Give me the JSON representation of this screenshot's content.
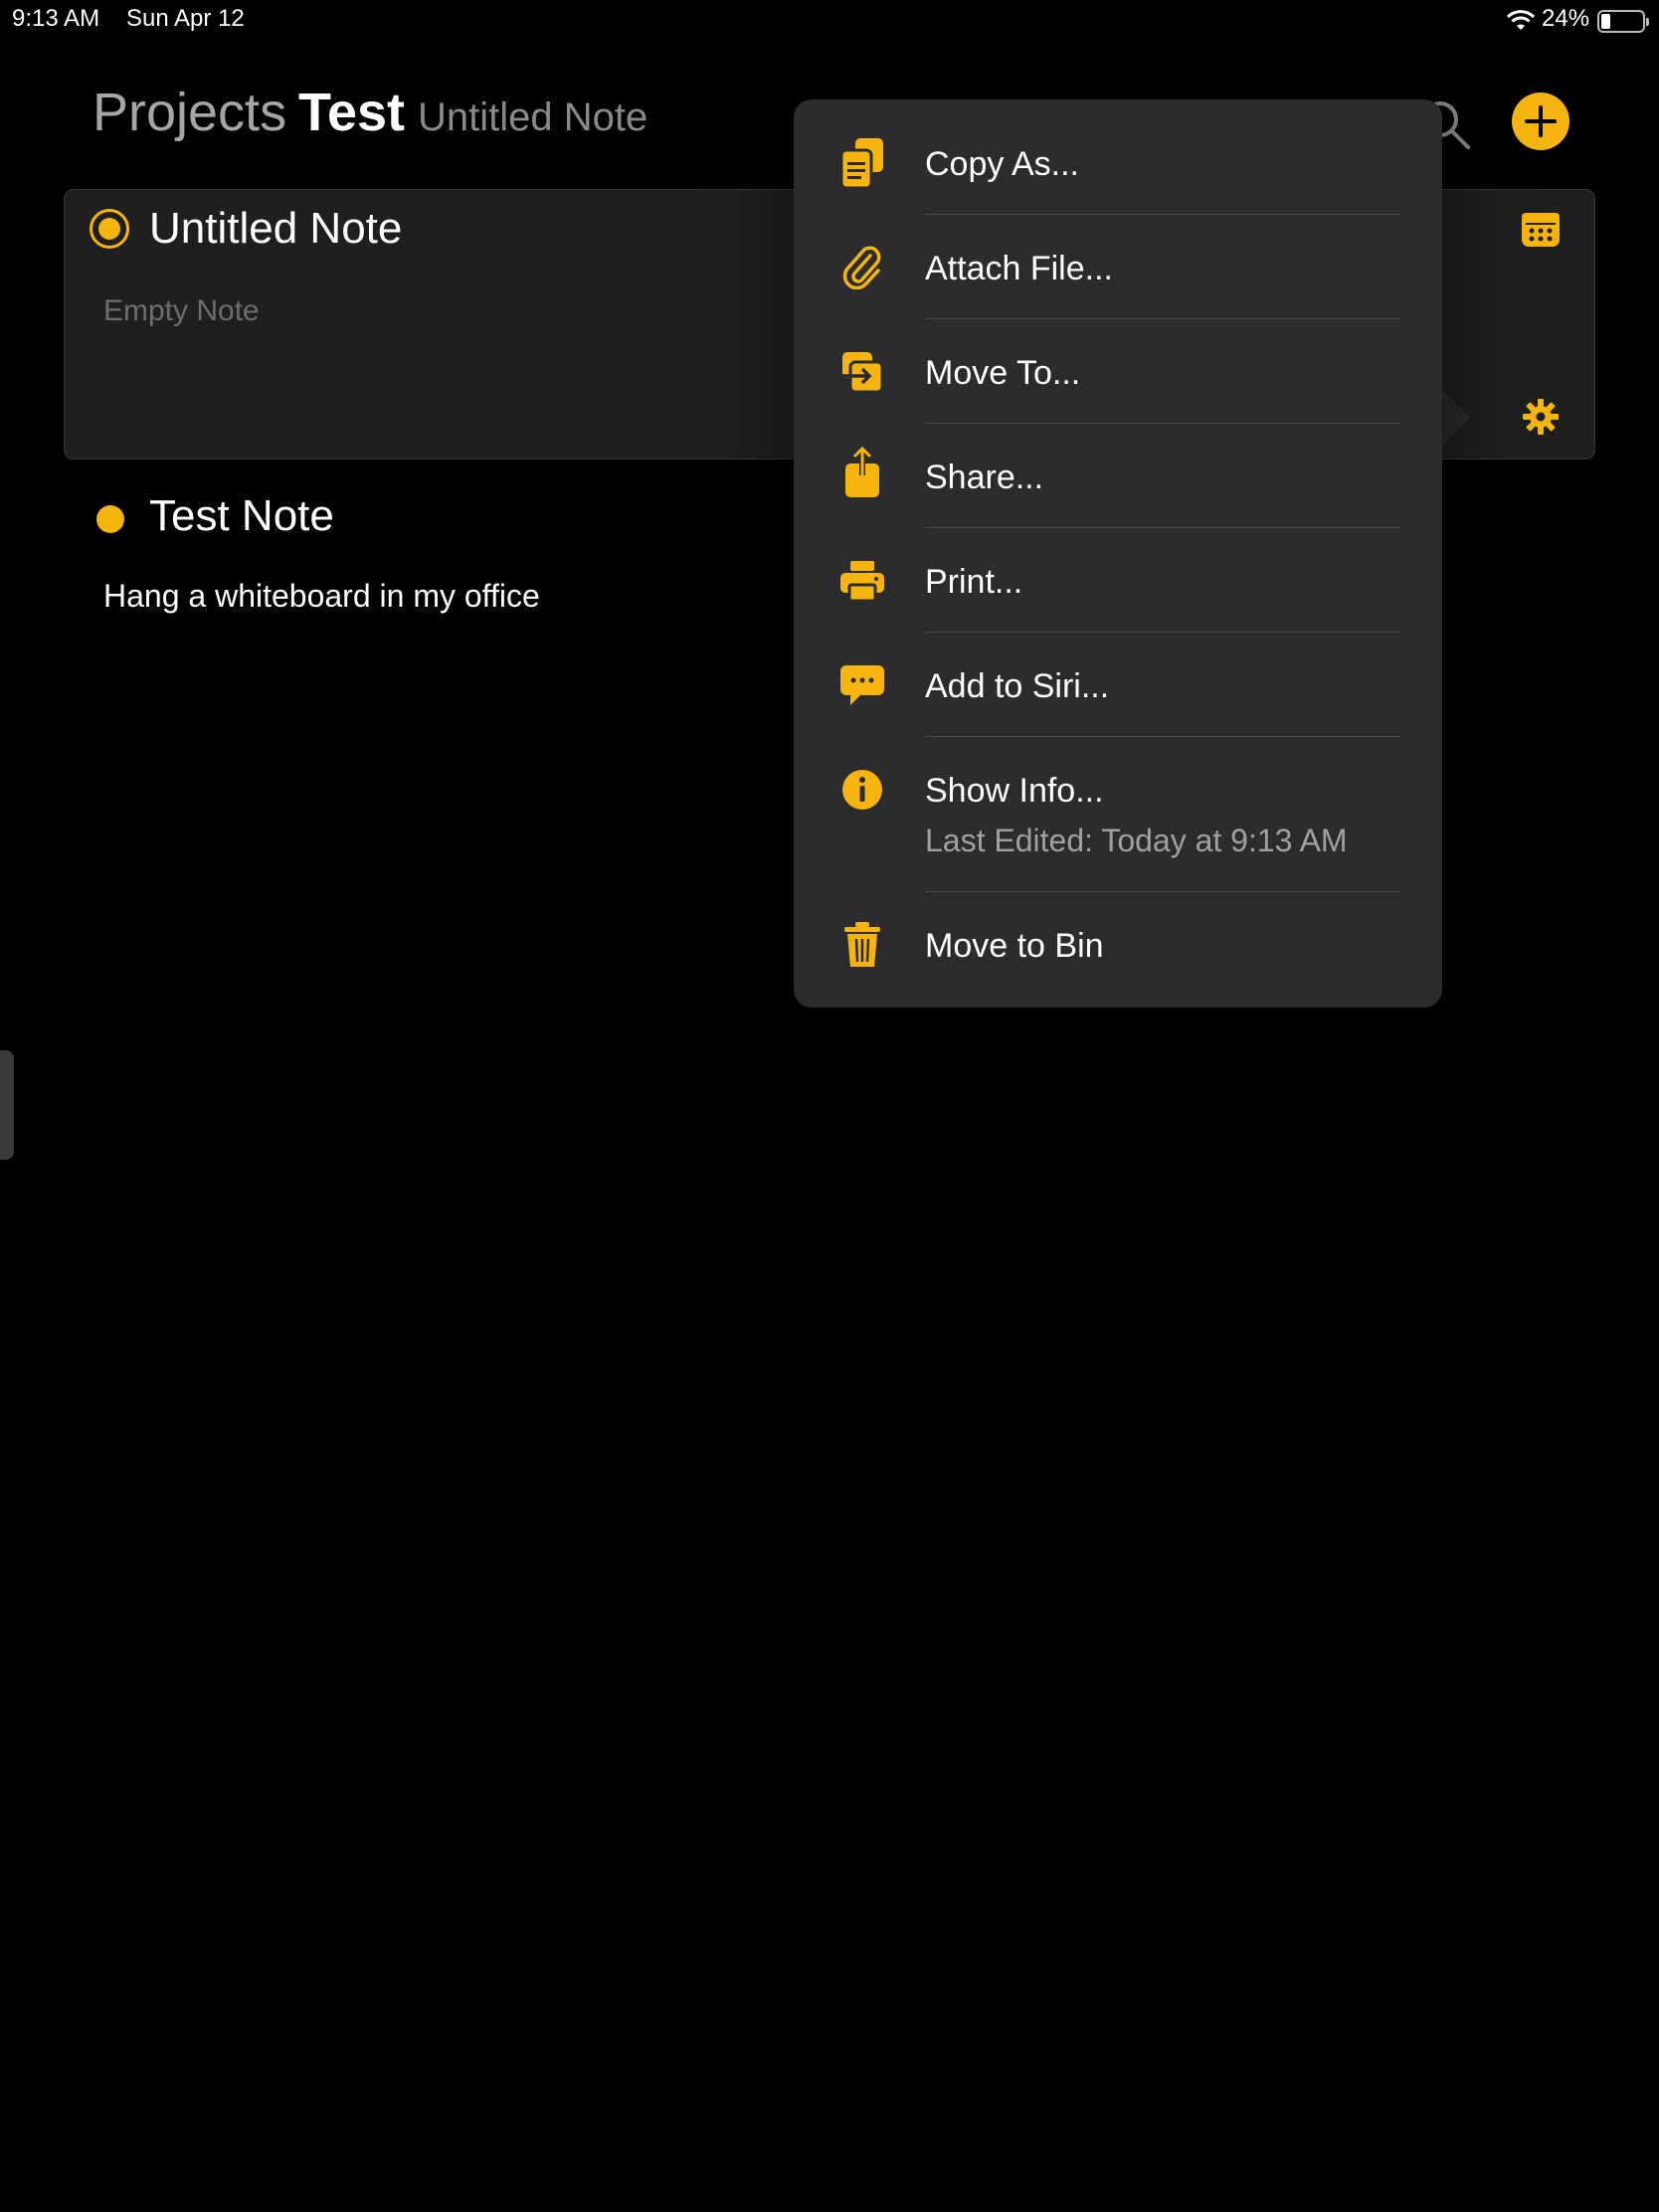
{
  "status_bar": {
    "time": "9:13 AM",
    "date": "Sun Apr 12",
    "battery": "24%",
    "battery_level": 0.24
  },
  "header": {
    "crumb_parent": "Projects",
    "crumb_current": "Test",
    "crumb_note": "Untitled Note"
  },
  "notes": [
    {
      "title": "Untitled Note",
      "body": "Empty Note",
      "state": "selected"
    },
    {
      "title": "Test Note",
      "body": "Hang a whiteboard in my office",
      "state": "normal"
    }
  ],
  "menu": {
    "items": [
      {
        "label": "Copy As...",
        "icon": "copy-icon"
      },
      {
        "label": "Attach File...",
        "icon": "paperclip-icon"
      },
      {
        "label": "Move To...",
        "icon": "move-icon"
      },
      {
        "label": "Share...",
        "icon": "share-icon"
      },
      {
        "label": "Print...",
        "icon": "printer-icon"
      },
      {
        "label": "Add to Siri...",
        "icon": "siri-icon"
      },
      {
        "label": "Show Info...",
        "sub": "Last Edited: Today at 9:13 AM",
        "icon": "info-icon"
      },
      {
        "label": "Move to Bin",
        "icon": "trash-icon"
      }
    ]
  },
  "colors": {
    "accent": "#f5b40e",
    "background": "#000000",
    "card": "#1f1f1f",
    "popover": "#2c2c2e"
  }
}
